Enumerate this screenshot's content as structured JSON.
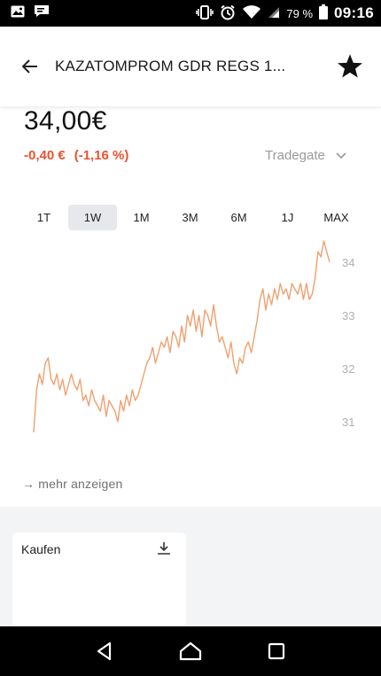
{
  "status_bar": {
    "battery_percent": "79 %",
    "time": "09:16",
    "icons": [
      "image-icon",
      "message-icon",
      "vibrate-icon",
      "alarm-icon",
      "wifi-icon",
      "signal-icon",
      "battery-icon"
    ]
  },
  "header": {
    "title": "KAZATOMPROM GDR REGS 1...",
    "back_icon": "arrow-left-icon",
    "favorite_icon": "star-icon"
  },
  "quote": {
    "price": "34,00€",
    "change_abs": "-0,40 €",
    "change_pct": "(-1,16 %)",
    "exchange": "Tradegate",
    "change_color": "#e8532d"
  },
  "ranges": {
    "items": [
      "1T",
      "1W",
      "1M",
      "3M",
      "6M",
      "1J",
      "MAX"
    ],
    "selected": "1W"
  },
  "chart_data": {
    "type": "line",
    "ylim": [
      30.5,
      34.5
    ],
    "yticks": [
      "34",
      "33",
      "32",
      "31"
    ],
    "line_color": "#f0a070",
    "values": [
      30.8,
      31.6,
      31.9,
      31.7,
      32.1,
      32.2,
      31.8,
      31.7,
      31.9,
      31.6,
      31.8,
      31.5,
      31.7,
      31.9,
      31.7,
      31.6,
      31.8,
      31.4,
      31.5,
      31.3,
      31.6,
      31.4,
      31.3,
      31.2,
      31.5,
      31.1,
      31.4,
      31.3,
      31.2,
      31.0,
      31.4,
      31.2,
      31.5,
      31.3,
      31.6,
      31.4,
      31.5,
      31.7,
      31.9,
      32.1,
      32.2,
      32.4,
      32.1,
      32.3,
      32.5,
      32.4,
      32.6,
      32.3,
      32.7,
      32.6,
      32.4,
      32.8,
      32.5,
      33.0,
      32.8,
      33.1,
      32.7,
      33.0,
      32.6,
      33.1,
      33.0,
      32.8,
      33.2,
      32.8,
      32.5,
      32.6,
      32.4,
      32.2,
      32.5,
      32.1,
      31.9,
      32.2,
      32.1,
      32.4,
      32.5,
      32.3,
      32.6,
      32.9,
      33.3,
      33.5,
      33.1,
      33.4,
      33.2,
      33.5,
      33.3,
      33.6,
      33.4,
      33.5,
      33.3,
      33.6,
      33.5,
      33.4,
      33.6,
      33.3,
      33.6,
      33.3,
      33.4,
      33.7,
      34.2,
      34.1,
      34.4,
      34.2,
      34.0
    ]
  },
  "links": {
    "more": "→ mehr anzeigen"
  },
  "card": {
    "title": "Kaufen",
    "icon": "download-icon"
  },
  "navbar": {
    "icons": [
      "back-triangle-icon",
      "home-icon",
      "recents-icon"
    ]
  }
}
